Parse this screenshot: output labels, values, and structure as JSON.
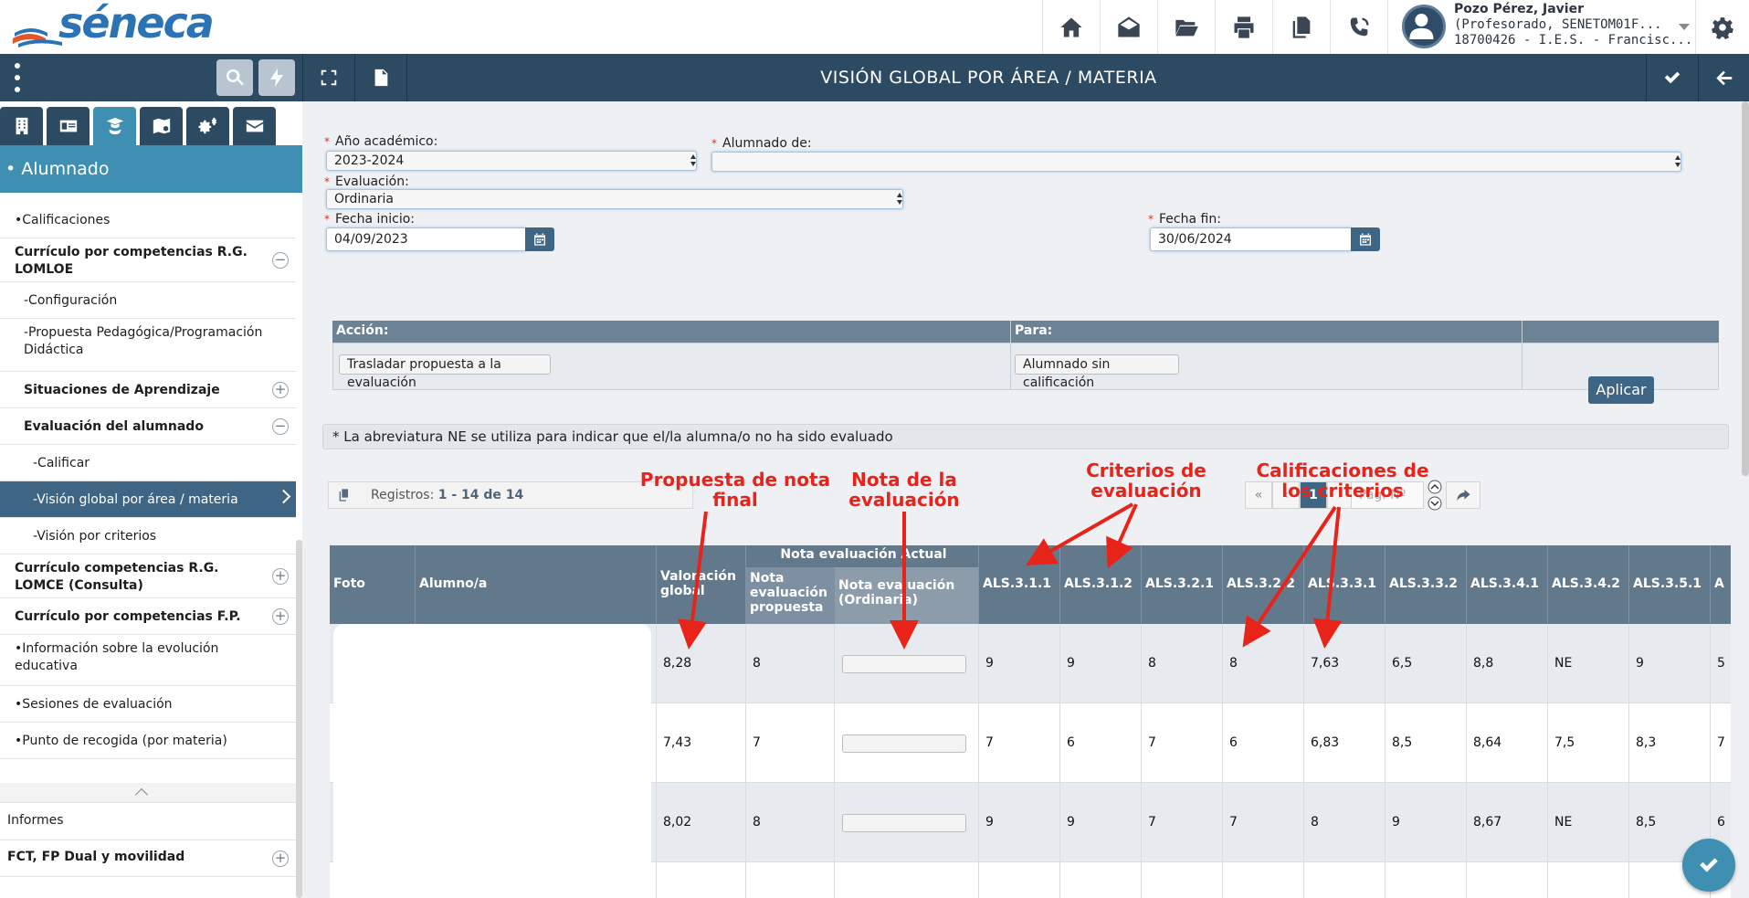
{
  "app": {
    "logo_text": "séneca",
    "page_title": "VISIÓN GLOBAL POR ÁREA / MATERIA"
  },
  "user": {
    "name": "Pozo Pérez, Javier",
    "role": "(Profesorado, SENETOM01F...",
    "center": "18700426 - I.E.S. - Francisc..."
  },
  "top_icons": [
    "home-icon",
    "mail-open-icon",
    "folder-icon",
    "printer-icon",
    "documents-icon",
    "phone-icon"
  ],
  "sidebar": {
    "tabs": [
      "building-icon",
      "id-card-icon",
      "students-icon",
      "map-icon",
      "gears-icon",
      "envelope-icon"
    ],
    "section": "• Alumnado",
    "items": [
      {
        "label": "•Calificaciones",
        "bold": false,
        "indent": 16,
        "plus": ""
      },
      {
        "label": "Currículo por competencias R.G. LOMLOE",
        "bold": true,
        "indent": 16,
        "plus": "−"
      },
      {
        "label": "-Configuración",
        "bold": false,
        "indent": 26,
        "plus": ""
      },
      {
        "label": "-Propuesta Pedagógica/Programación Didáctica",
        "bold": false,
        "indent": 26,
        "plus": ""
      },
      {
        "label": "Situaciones de Aprendizaje",
        "bold": true,
        "indent": 26,
        "plus": "+"
      },
      {
        "label": "Evaluación del alumnado",
        "bold": true,
        "indent": 26,
        "plus": "−"
      },
      {
        "label": "-Calificar",
        "bold": false,
        "indent": 36,
        "plus": ""
      },
      {
        "label": "-Visión global por área / materia",
        "bold": false,
        "indent": 36,
        "plus": "",
        "active": true
      },
      {
        "label": "-Visión por criterios",
        "bold": false,
        "indent": 36,
        "plus": ""
      },
      {
        "label": "Currículo competencias R.G. LOMCE (Consulta)",
        "bold": true,
        "indent": 16,
        "plus": "+"
      },
      {
        "label": "Currículo por competencias F.P.",
        "bold": true,
        "indent": 16,
        "plus": "+"
      },
      {
        "label": "•Información sobre la evolución educativa",
        "bold": false,
        "indent": 16,
        "plus": ""
      },
      {
        "label": "•Sesiones de evaluación",
        "bold": false,
        "indent": 16,
        "plus": ""
      },
      {
        "label": "•Punto de recogida (por materia)",
        "bold": false,
        "indent": 16,
        "plus": ""
      }
    ],
    "bottom_items": [
      {
        "label": "Informes",
        "bold": false
      },
      {
        "label": "FCT, FP Dual y movilidad",
        "bold": true
      }
    ]
  },
  "form": {
    "anio_label": "Año académico:",
    "anio_value": "2023-2024",
    "alumnado_label": "Alumnado de:",
    "alumnado_value": "",
    "evaluacion_label": "Evaluación:",
    "evaluacion_value": "Ordinaria",
    "fecha_inicio_label": "Fecha inicio:",
    "fecha_inicio_value": "04/09/2023",
    "fecha_fin_label": "Fecha fin:",
    "fecha_fin_value": "30/06/2024"
  },
  "accion": {
    "accion_header": "Acción:",
    "para_header": "Para:",
    "accion_value": "Trasladar propuesta a la evaluación",
    "para_value": "Alumnado sin calificación",
    "apply_label": "Aplicar"
  },
  "note": "* La abreviatura NE se utiliza para indicar que el/la alumna/o no ha sido evaluado",
  "records": {
    "prefix": "Registros: ",
    "range": "1 - 14 de 14"
  },
  "pager": {
    "first": "«",
    "prev": "‹",
    "current": "1",
    "next": "›",
    "last": "»",
    "page_placeholder": "Pág. Nº"
  },
  "table": {
    "h_foto": "Foto",
    "h_alumno": "Alumno/a",
    "h_valoracion": "Valoración global",
    "h_nota_group": "Nota evaluación Actual",
    "h_nota_prop": "Nota evaluación propuesta",
    "h_nota_ord": "Nota evaluación (Ordinaria)",
    "criteria": [
      "ALS.3.1.1",
      "ALS.3.1.2",
      "ALS.3.2.1",
      "ALS.3.2.2",
      "ALS.3.3.1",
      "ALS.3.3.2",
      "ALS.3.4.1",
      "ALS.3.4.2",
      "ALS.3.5.1",
      "A"
    ],
    "rows": [
      {
        "valoracion": "8,28",
        "propuesta": "8",
        "crit": [
          "9",
          "9",
          "8",
          "8",
          "7,63",
          "6,5",
          "8,8",
          "NE",
          "9",
          "5"
        ]
      },
      {
        "valoracion": "7,43",
        "propuesta": "7",
        "crit": [
          "7",
          "6",
          "7",
          "6",
          "6,83",
          "8,5",
          "8,64",
          "7,5",
          "8,3",
          "7"
        ]
      },
      {
        "valoracion": "8,02",
        "propuesta": "8",
        "crit": [
          "9",
          "9",
          "7",
          "7",
          "8",
          "9",
          "8,67",
          "NE",
          "8,5",
          "6"
        ]
      }
    ]
  },
  "annotations": {
    "propuesta": "Propuesta de nota final",
    "nota_eval": "Nota de la evaluación",
    "criterios": "Criterios de evaluación",
    "calificaciones": "Calificaciones de los criterios"
  },
  "colors": {
    "header_band": "#2d4a63",
    "accent": "#3f8fb3",
    "annotation": "#e8231a"
  }
}
